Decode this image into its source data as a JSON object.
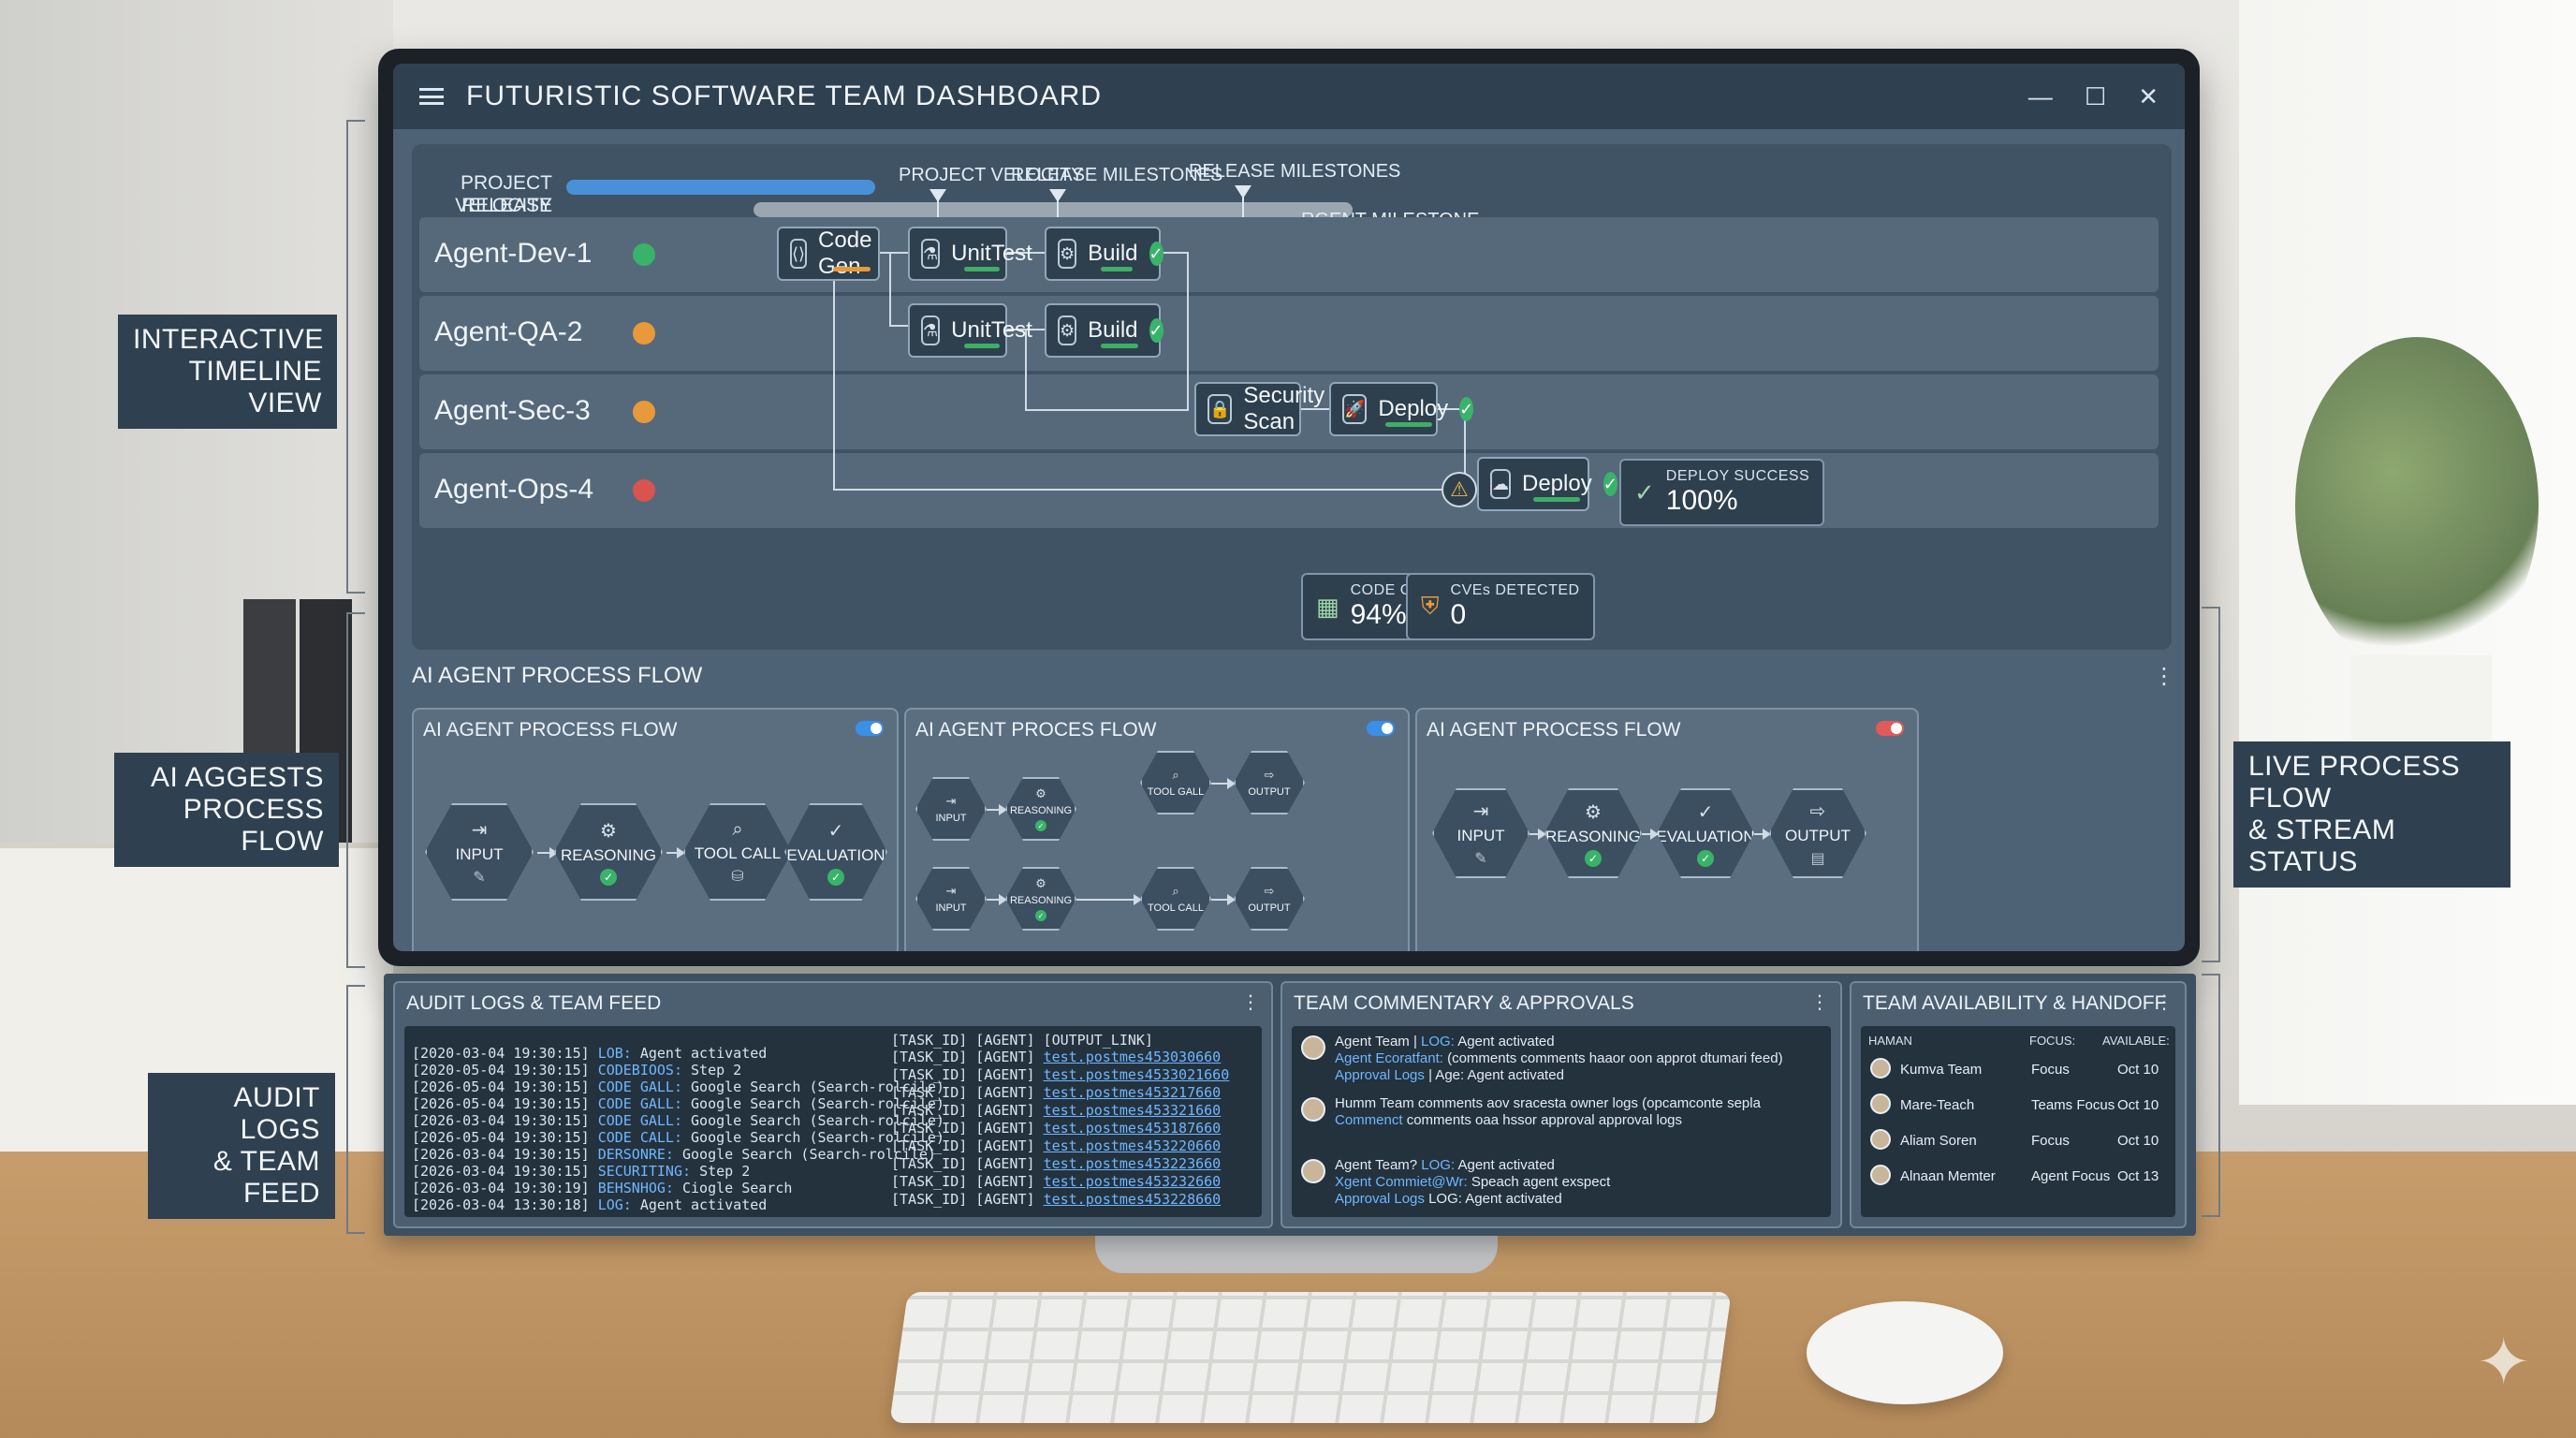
{
  "app": {
    "title": "FUTURISTIC SOFTWARE TEAM DASHBOARD",
    "min": "—",
    "max": "☐",
    "close": "✕"
  },
  "milestones": {
    "label_velocity": "PROJECT VELOCITY",
    "label_release": "RELEASE MILESTONES",
    "marker1": "PROJECT VELOCITY",
    "marker2": "RELEASE MILESTONES",
    "marker3": "RELEASE MILESTONES",
    "end_label": "RGENT MILESTONE"
  },
  "lanes": [
    {
      "name": "Agent-Dev-1",
      "status_color": "#39b36a",
      "status_icon": "✓"
    },
    {
      "name": "Agent-QA-2",
      "status_color": "#e89a3a",
      "status_icon": "●"
    },
    {
      "name": "Agent-Sec-3",
      "status_color": "#e89a3a",
      "status_icon": "●"
    },
    {
      "name": "Agent-Ops-4",
      "status_color": "#d9534f",
      "status_icon": "✕"
    }
  ],
  "tasks": {
    "codegen": "Code Gen",
    "unittest1": "UnitTest",
    "build1": "Build",
    "unittest2": "UnitTest",
    "build2": "Build",
    "security": "Security Scan",
    "deploy1": "Deploy",
    "deploy2": "Deploy"
  },
  "kpis": {
    "deploy_label": "DEPLOY SUCCESS",
    "deploy_value": "100%",
    "coverage_label": "CODE COVERAGE",
    "coverage_value": "94%",
    "cves_label": "CVEs DETECTED",
    "cves_value": "0"
  },
  "process": {
    "heading": "AI AGENT PROCESS FLOW",
    "panels": [
      {
        "title": "AI AGENT PROCESS FLOW",
        "toggle": "#3a8fe8"
      },
      {
        "title": "AI AGENT PROCES FLOW",
        "toggle": "#3a8fe8"
      },
      {
        "title": "AI AGENT PROCESS FLOW",
        "toggle": "#e05a5a"
      }
    ],
    "nodes": {
      "input": "INPUT",
      "reasoning": "REASONING",
      "tool_call": "TOOL CALL",
      "tool_gall": "TOOL GALL",
      "evaluation": "EVALUATION",
      "output": "OUTPUT"
    }
  },
  "audit": {
    "title": "AUDIT LOGS & TEAM FEED",
    "lines": [
      {
        "ts": "[2020-03-04 19:30:15]",
        "key": "LOB:",
        "msg": "Agent activated"
      },
      {
        "ts": "[2020-05-04 19:30:15]",
        "key": "CODEBIOOS:",
        "msg": "Step 2"
      },
      {
        "ts": "[2026-05-04 19:30:15]",
        "key": "CODE GALL:",
        "msg": "Google Search (Search-rolcile)"
      },
      {
        "ts": "[2026-05-04 19:30:15]",
        "key": "CODE GALL:",
        "msg": "Google Search (Search-rolcile)"
      },
      {
        "ts": "[2026-03-04 19:30:15]",
        "key": "CODE GALL:",
        "msg": "Google Search (Search-rolcile)"
      },
      {
        "ts": "[2026-05-04 19:30:15]",
        "key": "CODE CALL:",
        "msg": "Google Search (Search-rolcile)"
      },
      {
        "ts": "[2026-03-04 19:30:15]",
        "key": "DERSONRE:",
        "msg": "Google Search (Search-rolcile)"
      },
      {
        "ts": "[2026-03-04 19:30:15]",
        "key": "SECURITING:",
        "msg": "Step 2"
      },
      {
        "ts": "[2026-03-04 19:30:19]",
        "key": "BEHSNHOG:",
        "msg": "Ciogle Search"
      },
      {
        "ts": "[2026-03-04 13:30:18]",
        "key": "LOG:",
        "msg": "Agent activated"
      }
    ],
    "cols": {
      "task": "[TASK_ID]",
      "agent": "[AGENT]",
      "link": "[OUTPUT_LINK]"
    },
    "rows": [
      {
        "task": "[TASK_ID]",
        "agent": "[AGENT]",
        "link": "test.postmes453030660"
      },
      {
        "task": "[TASK_ID]",
        "agent": "[AGENT]",
        "link": "test.postmes4533021660"
      },
      {
        "task": "[TASK_ID]",
        "agent": "[AGENT]",
        "link": "test.postmes453217660"
      },
      {
        "task": "[TASK_ID]",
        "agent": "[AGENT]",
        "link": "test.postmes453321660"
      },
      {
        "task": "[TASK_ID]",
        "agent": "[AGENT]",
        "link": "test.postmes453187660"
      },
      {
        "task": "[TASK_ID]",
        "agent": "[AGENT]",
        "link": "test.postmes453220660"
      },
      {
        "task": "[TASK_ID]",
        "agent": "[AGENT]",
        "link": "test.postmes453223660"
      },
      {
        "task": "[TASK_ID]",
        "agent": "[AGENT]",
        "link": "test.postmes453232660"
      },
      {
        "task": "[TASK_ID]",
        "agent": "[AGENT]",
        "link": "test.postmes453228660"
      }
    ]
  },
  "commentary": {
    "title": "TEAM COMMENTARY & APPROVALS",
    "items": [
      {
        "l1a": "Agent Team | ",
        "l1b": "LOG:",
        "l1c": " Agent activated",
        "l2a": "Agent Ecoratfant:",
        "l2b": " (comments comments haaor oon approt dtumari feed)",
        "l3a": "Approval Logs",
        "l3b": " | Age: Agent activated"
      },
      {
        "l1a": "Humm Team",
        "l1b": "",
        "l1c": " comments aov sracesta owner logs (opcamconte sepla",
        "l2a": "Commenct",
        "l2b": " comments oaa hssor approval approval logs",
        "l3a": "",
        "l3b": ""
      },
      {
        "l1a": "Agent Team? ",
        "l1b": "LOG:",
        "l1c": " Agent activated",
        "l2a": "Xgent Commiet@Wr:",
        "l2b": " Speach agent exspect",
        "l3a": "Approval Logs",
        "l3b": " LOG: Agent activated"
      }
    ]
  },
  "availability": {
    "title": "TEAM AVAILABILITY & HANDOFF",
    "headers": {
      "human": "HAMAN",
      "focus": "FOCUS:",
      "available": "AVAILABLE:"
    },
    "rows": [
      {
        "name": "Kumva Team",
        "focus": "Focus",
        "date": "Oct 10"
      },
      {
        "name": "Mare-Teach",
        "focus": "Teams Focus",
        "date": "Oct 10"
      },
      {
        "name": "Aliam Soren",
        "focus": "Focus",
        "date": "Oct 10"
      },
      {
        "name": "Alnaan Memter",
        "focus": "Agent Focus",
        "date": "Oct 13"
      }
    ]
  },
  "callouts": {
    "timeline": "INTERACTIVE\nTIMELINE VIEW",
    "process": "AI AGGESTS\nPROCESS FLOW",
    "audit": "AUDIT LOGS\n& TEAM FEED",
    "live": "LIVE PROCESS FLOW\n& STREAM STATUS"
  }
}
